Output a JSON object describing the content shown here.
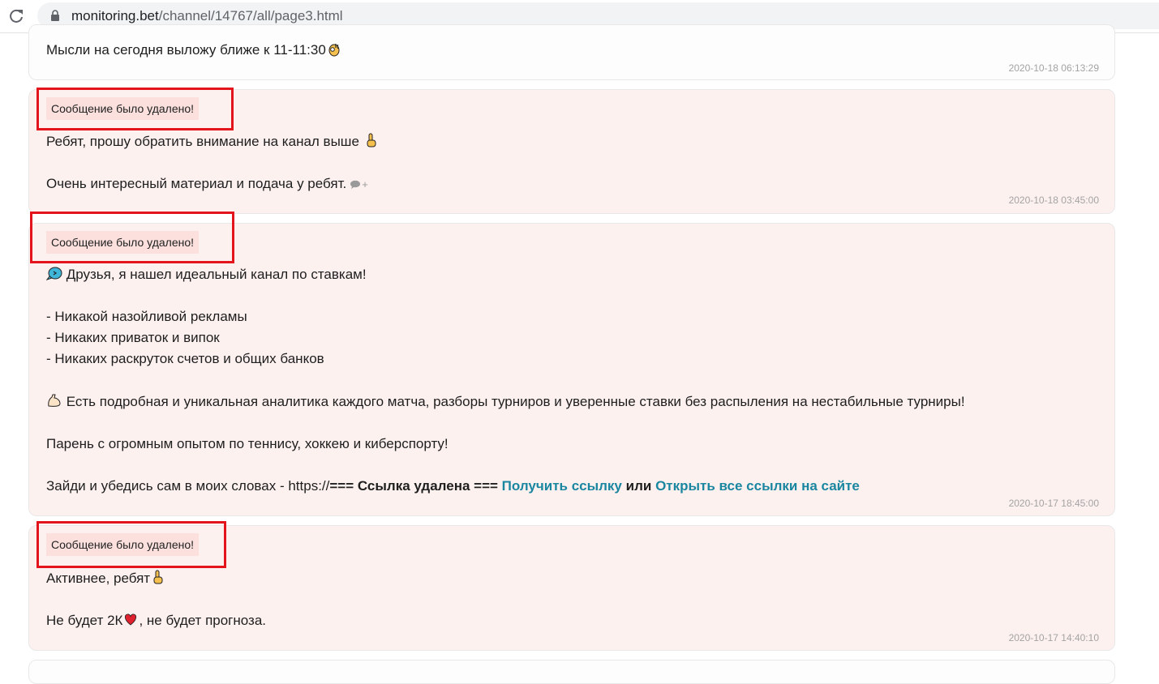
{
  "browser": {
    "url_host": "monitoring.bet",
    "url_path": "/channel/14767/all/page3.html"
  },
  "messages": [
    {
      "lines": [
        "Мысли на сегодня выложу ближе к 11-11:30"
      ],
      "timestamp": "2020-10-18 06:13:29"
    },
    {
      "deleted_label": "Сообщение было удалено!",
      "lines": [
        "Ребят, прошу обратить внимание на канал выше",
        "Очень интересный материал и подача у ребят."
      ],
      "comment_plus": "+",
      "timestamp": "2020-10-18 03:45:00"
    },
    {
      "deleted_label": "Сообщение было удалено!",
      "lines": [
        "Друзья, я нашел идеальный канал по ставкам!",
        "- Никакой назойливой рекламы",
        "- Никаких приваток и випок",
        "- Никаких раскруток счетов и общих банков",
        "Есть подробная и уникальная аналитика каждого матча, разборы турниров и уверенные ставки без распыления на нестабильные турниры!",
        "Парень с огромным опытом по теннису, хоккею и киберспорту!",
        "Зайди и убедись сам в моих словах - https://"
      ],
      "link_removed": "=== Ссылка удалена ===",
      "get_link": "Получить ссылку",
      "or_word": "или",
      "open_all_links": "Открыть все ссылки на сайте",
      "timestamp": "2020-10-17 18:45:00"
    },
    {
      "deleted_label": "Сообщение было удалено!",
      "lines": [
        "Активнее, ребят",
        "Не будет 2К",
        ", не будет прогноза."
      ],
      "timestamp": "2020-10-17 14:40:10"
    }
  ],
  "colors": {
    "highlight": "#e3141b",
    "link": "#1a86a0",
    "deleted_bg": "#fdf1f0"
  },
  "icons": [
    "reload-icon",
    "lock-icon",
    "ok-hand-emoji-icon",
    "pointing-up-emoji-icon",
    "comment-icon",
    "speech-bubble-emoji-icon",
    "flexed-biceps-emoji-icon",
    "red-heart-emoji-icon"
  ]
}
